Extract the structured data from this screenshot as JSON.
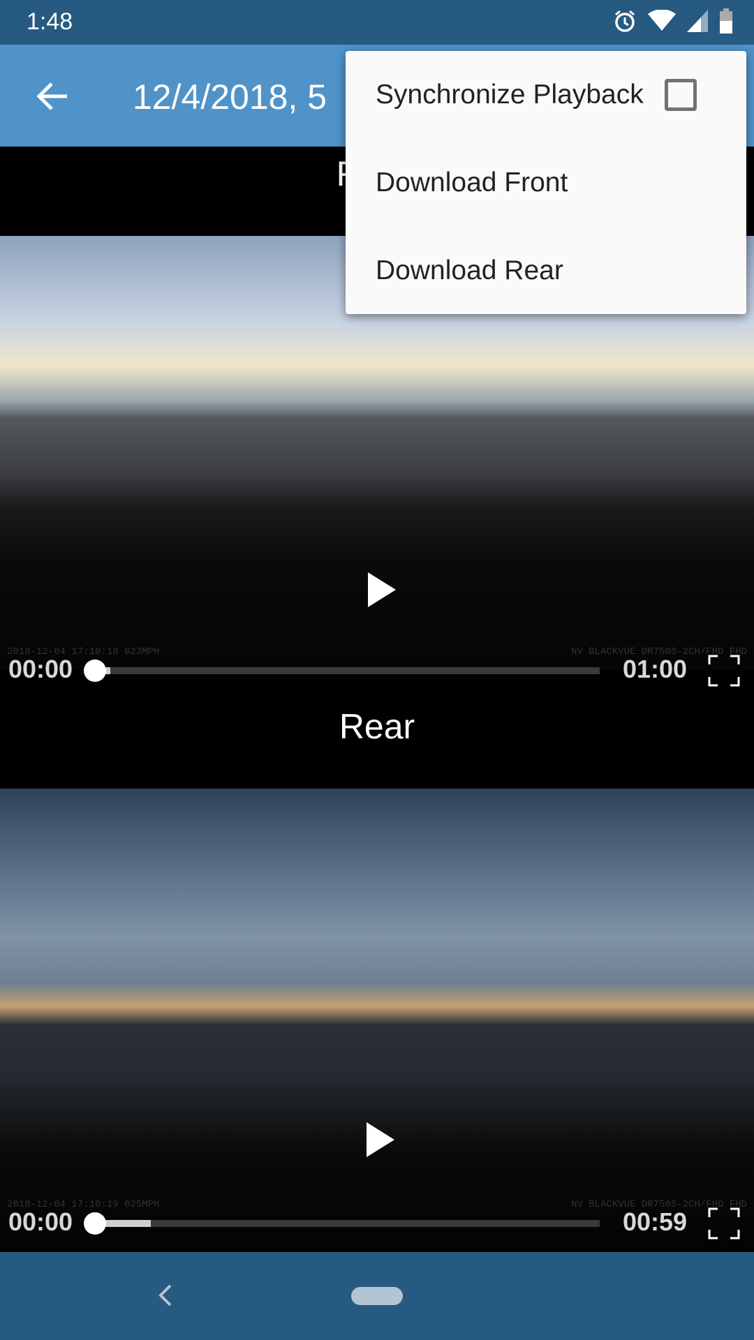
{
  "status_bar": {
    "time": "1:48",
    "icons": [
      "alarm-icon",
      "wifi-icon",
      "signal-icon",
      "battery-icon"
    ]
  },
  "app_bar": {
    "title": "12/4/2018, 5",
    "back_icon": "arrow-left-icon"
  },
  "front": {
    "label": "Front",
    "overlay_left": "2018-12-04 17:10:18  023MPH",
    "overlay_right": "NV   BLACKVUE DR750S-2CH/FHD FHD",
    "current_time": "00:00",
    "duration": "01:00",
    "buffered_percent": 3
  },
  "rear": {
    "label": "Rear",
    "overlay_left": "2018-12-04 17:10:19  025MPH",
    "overlay_right": "NV   BLACKVUE DR750S-2CH/FHD FHD",
    "current_time": "00:00",
    "duration": "00:59",
    "buffered_percent": 11
  },
  "menu": {
    "items": [
      {
        "label": "Synchronize Playback",
        "checked": false
      },
      {
        "label": "Download Front"
      },
      {
        "label": "Download Rear"
      }
    ]
  },
  "colors": {
    "status_bar": "#275a80",
    "app_bar": "#4f93c9",
    "menu_bg": "#fafafa"
  }
}
